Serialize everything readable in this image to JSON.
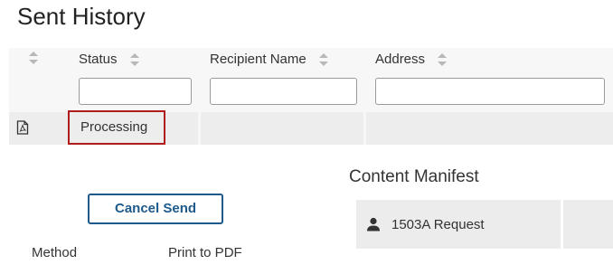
{
  "page": {
    "title": "Sent History"
  },
  "table": {
    "columns": [
      {
        "label": ""
      },
      {
        "label": "Status"
      },
      {
        "label": "Recipient Name"
      },
      {
        "label": "Address"
      }
    ],
    "filters": [
      {
        "value": "",
        "placeholder": ""
      },
      {
        "value": "",
        "placeholder": ""
      },
      {
        "value": "",
        "placeholder": ""
      }
    ],
    "rows": [
      {
        "icon": "pdf-file-icon",
        "status": "Processing",
        "recipient_name": "",
        "address": ""
      }
    ]
  },
  "details": {
    "cancel_label": "Cancel Send",
    "method_label": "Method",
    "method_value": "Print to PDF"
  },
  "manifest": {
    "title": "Content Manifest",
    "items": [
      {
        "icon": "person-icon",
        "label": "1503A Request"
      }
    ]
  },
  "colors": {
    "accent": "#1e5a8c",
    "highlight_border": "#b01c1c",
    "row_background": "#ededed",
    "header_background": "#f7f7f7"
  }
}
